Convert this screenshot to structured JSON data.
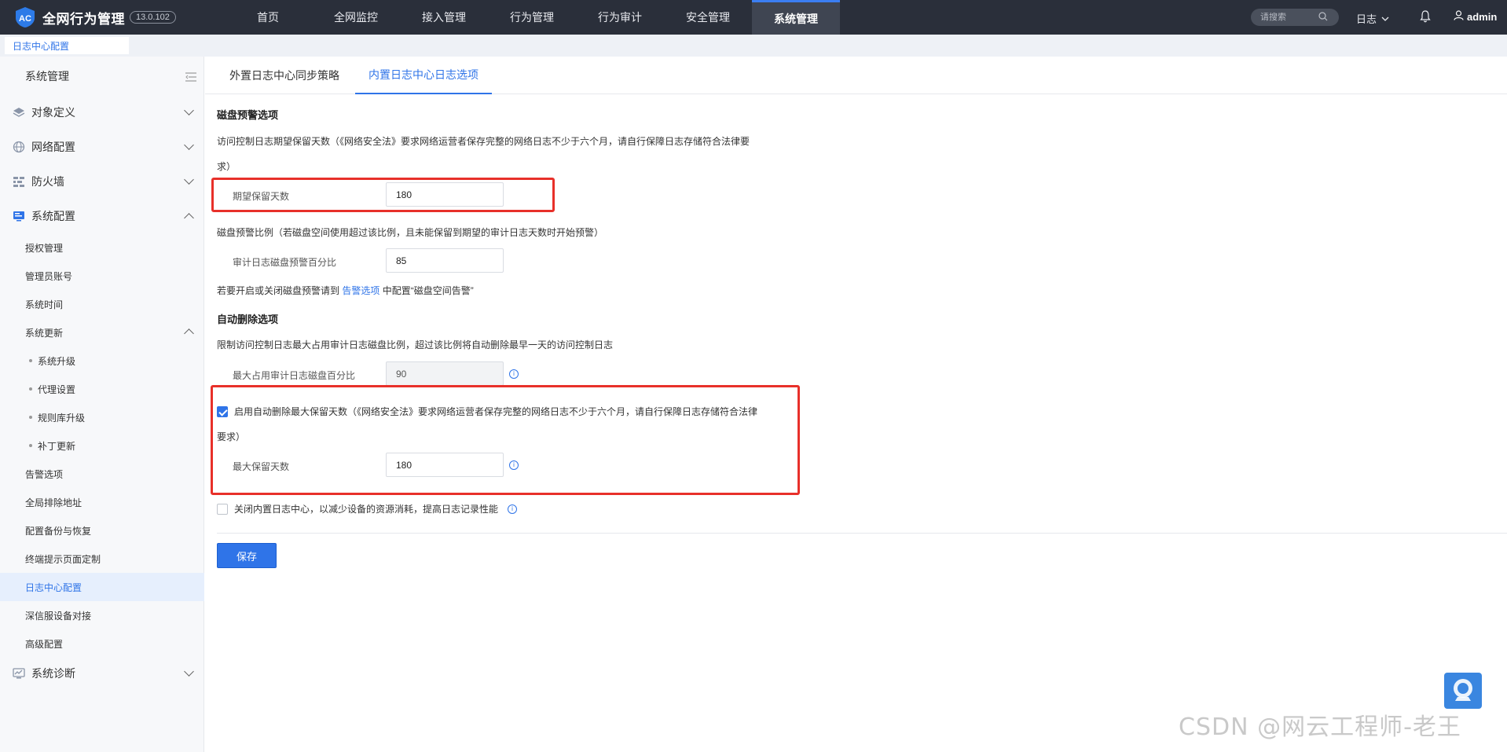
{
  "header": {
    "app_title": "全网行为管理",
    "version": "13.0.102",
    "nav": [
      "首页",
      "全网监控",
      "接入管理",
      "行为管理",
      "行为审计",
      "安全管理",
      "系统管理"
    ],
    "search_placeholder": "请搜索",
    "log_menu": "日志",
    "user": "admin"
  },
  "page_tab": "日志中心配置",
  "sidebar": {
    "title": "系统管理",
    "groups": {
      "object_def": "对象定义",
      "network": "网络配置",
      "firewall": "防火墙",
      "system": "系统配置",
      "diagnosis": "系统诊断"
    },
    "system_items": {
      "license": "授权管理",
      "admin_account": "管理员账号",
      "system_time": "系统时间",
      "system_update": "系统更新",
      "upgrade": "系统升级",
      "proxy": "代理设置",
      "rule_upgrade": "规则库升级",
      "patch": "补丁更新",
      "alert": "告警选项",
      "exclude": "全局排除地址",
      "backup": "配置备份与恢复",
      "terminal_page": "终端提示页面定制",
      "log_center": "日志中心配置",
      "sangfor_dock": "深信服设备对接",
      "advanced": "高级配置"
    }
  },
  "tabs": {
    "external": "外置日志中心同步策略",
    "internal": "内置日志中心日志选项"
  },
  "disk_alert": {
    "title": "磁盘预警选项",
    "retention_desc_1": "访问控制日志期望保留天数（《网络安全法》要求网络运营者保存完整的网络日志不少于六个月，请自行保障日志存储符合法律要",
    "retention_desc_2": "求）",
    "retention_label": "期望保留天数",
    "retention_value": "180",
    "ratio_desc": "磁盘预警比例（若磁盘空间使用超过该比例，且未能保留到期望的审计日志天数时开始预警）",
    "ratio_label": "审计日志磁盘预警百分比",
    "ratio_value": "85",
    "hint_prefix": "若要开启或关闭磁盘预警请到",
    "hint_link": "告警选项",
    "hint_suffix": "中配置“磁盘空间告警”"
  },
  "auto_delete": {
    "title": "自动删除选项",
    "limit_desc": "限制访问控制日志最大占用审计日志磁盘比例，超过该比例将自动删除最早一天的访问控制日志",
    "max_ratio_label": "最大占用审计日志磁盘百分比",
    "max_ratio_value": "90",
    "enable_label_1": "启用自动删除最大保留天数（《网络安全法》要求网络运营者保存完整的网络日志不少于六个月，请自行保障日志存储符合法律",
    "enable_label_2": "要求）",
    "enable_checked": true,
    "max_days_label": "最大保留天数",
    "max_days_value": "180",
    "disable_label": "关闭内置日志中心，以减少设备的资源消耗，提高日志记录性能",
    "disable_checked": false
  },
  "save_label": "保存",
  "watermark": "CSDN @网云工程师-老王",
  "colors": {
    "topbar": "#2a2f3a",
    "accent": "#2f74e8",
    "highlight": "#e8302a"
  }
}
